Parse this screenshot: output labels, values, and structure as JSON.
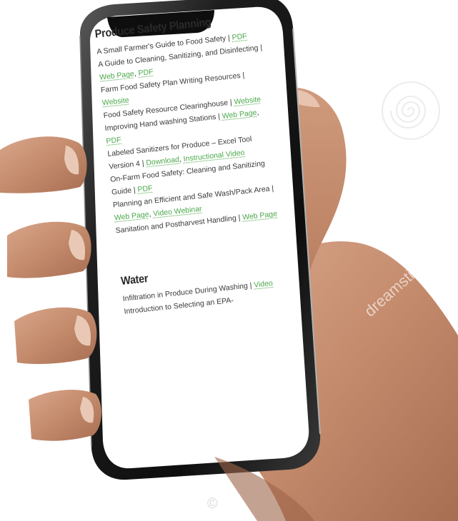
{
  "sections": [
    {
      "title": "Produce Safety Planning",
      "items": [
        {
          "text": "A Small Farmer's Guide to Food Safety | ",
          "links": [
            "PDF"
          ]
        },
        {
          "text": "A Guide to Cleaning, Sanitizing, and Disinfecting | ",
          "links": [
            "Web Page",
            "PDF"
          ]
        },
        {
          "text": "Farm Food Safety Plan Writing Resources | ",
          "links": [
            "Website"
          ]
        },
        {
          "text": "Food Safety Resource Clearinghouse | ",
          "links": [
            "Website"
          ]
        },
        {
          "text": "Improving Hand washing Stations | ",
          "links": [
            "Web Page",
            "PDF"
          ]
        },
        {
          "text": "Labeled Sanitizers for Produce – Excel Tool Version 4 | ",
          "links": [
            "Download",
            "Instructional Video"
          ]
        },
        {
          "text": "On-Farm Food Safety: Cleaning and Sanitizing Guide | ",
          "links": [
            "PDF"
          ]
        },
        {
          "text": "Planning an Efficient and Safe Wash/Pack Area | ",
          "links": [
            "Web Page",
            "Video Webinar"
          ]
        },
        {
          "text": "Sanitation and Postharvest Handling | ",
          "links": [
            "Web Page"
          ]
        }
      ]
    },
    {
      "title": "Water",
      "items": [
        {
          "text": "Infiltration in Produce During Washing | ",
          "links": [
            "Video"
          ]
        },
        {
          "text": "Introduction to Selecting an EPA-",
          "links": []
        }
      ]
    }
  ],
  "watermark": {
    "text": "dreamstime",
    "mark": "©"
  },
  "colors": {
    "link": "#4aa84a",
    "phone_frame": "#1a1a1a",
    "screen": "#ffffff",
    "skin": "#c89276"
  }
}
